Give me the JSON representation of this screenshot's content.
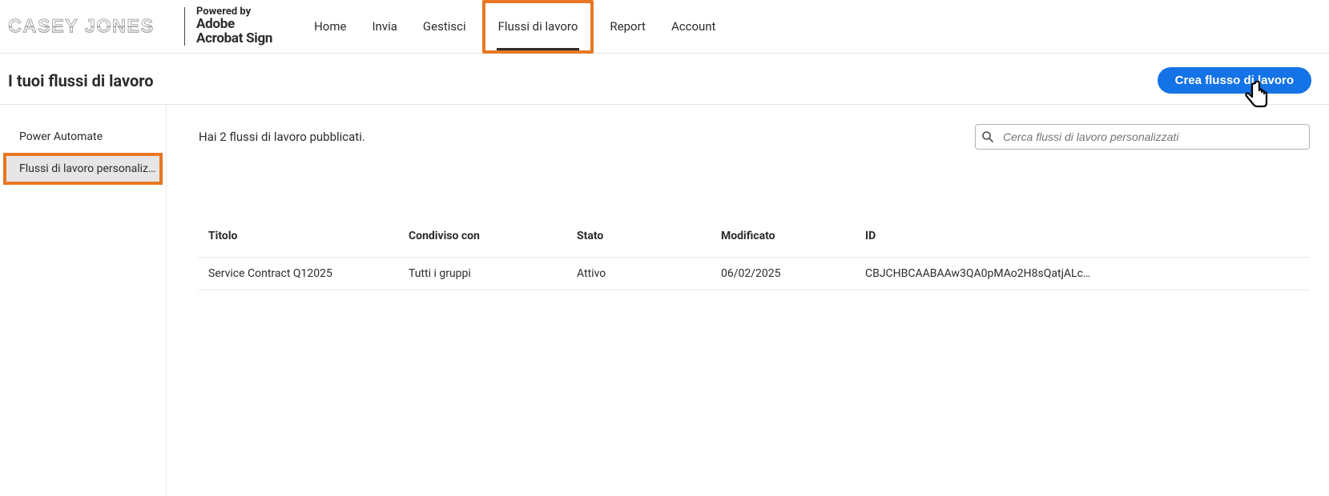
{
  "header": {
    "brand_name": "CASEY JONES",
    "powered_by_label": "Powered by",
    "powered_line1": "Adobe",
    "powered_line2": "Acrobat Sign",
    "nav": [
      {
        "label": "Home",
        "active": false
      },
      {
        "label": "Invia",
        "active": false
      },
      {
        "label": "Gestisci",
        "active": false
      },
      {
        "label": "Flussi di lavoro",
        "active": true,
        "highlighted": true
      },
      {
        "label": "Report",
        "active": false
      },
      {
        "label": "Account",
        "active": false
      }
    ]
  },
  "titlebar": {
    "title": "I tuoi flussi di lavoro",
    "create_button": "Crea flusso di lavoro"
  },
  "sidebar": {
    "items": [
      {
        "label": "Power Automate",
        "selected": false,
        "highlighted": false
      },
      {
        "label": "Flussi di lavoro personaliz…",
        "selected": true,
        "highlighted": true
      }
    ]
  },
  "main": {
    "count_text": "Hai 2 flussi di lavoro pubblicati.",
    "search_placeholder": "Cerca flussi di lavoro personalizzati",
    "columns": {
      "title": "Titolo",
      "shared": "Condiviso con",
      "state": "Stato",
      "modified": "Modificato",
      "id": "ID"
    },
    "rows": [
      {
        "title": "Service Contract Q12025",
        "shared": "Tutti i gruppi",
        "state": "Attivo",
        "modified": "06/02/2025",
        "id": "CBJCHBCAABAAw3QA0pMAo2H8sQatjALc…"
      }
    ]
  }
}
